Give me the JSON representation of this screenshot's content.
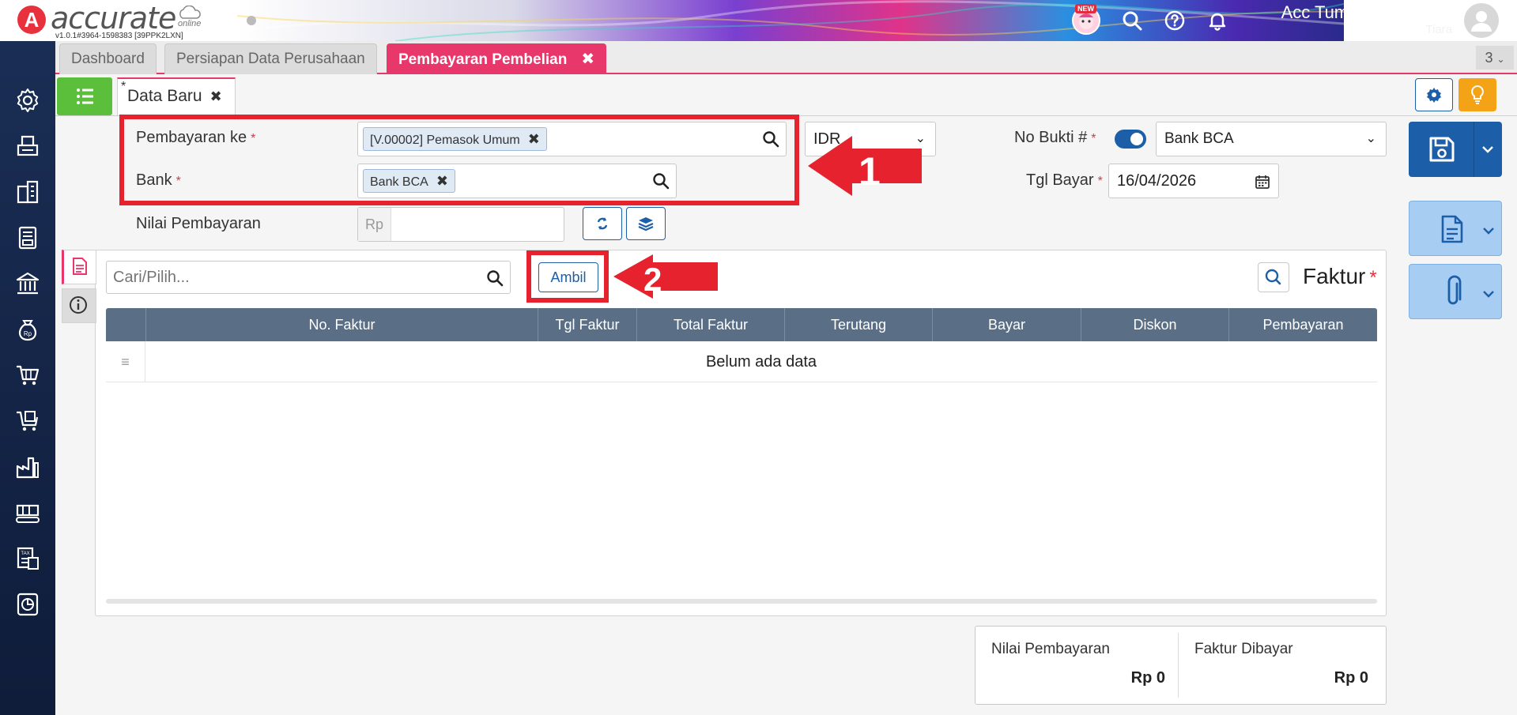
{
  "brand": {
    "logo_letter": "A",
    "name": "accurate",
    "cloud_text": "online",
    "version": "v1.0.1#3964-1598383 [39PPK2LXN]"
  },
  "header": {
    "new_badge": "NEW",
    "user_name": "Acc Tumbuh Bersama",
    "user_sub": "Tiara",
    "icons": [
      "search-icon",
      "help-icon",
      "bell-icon"
    ]
  },
  "sidebar": {
    "icons": [
      "gear-icon",
      "printer-icon",
      "building-icon",
      "book-icon",
      "bank-icon",
      "money-bag-icon",
      "cart-icon",
      "shopping-cart-icon",
      "factory-icon",
      "conveyor-icon",
      "tax-icon",
      "report-icon"
    ]
  },
  "tabs": {
    "items": [
      {
        "label": "Dashboard"
      },
      {
        "label": "Persiapan Data Perusahaan"
      },
      {
        "label": "Pembayaran Pembelian",
        "close": "✖"
      }
    ],
    "count": "3"
  },
  "subtab": {
    "star": "*",
    "label": "Data Baru",
    "close": "✖"
  },
  "form": {
    "pembayaran_ke_label": "Pembayaran ke",
    "pembayaran_ke_value": "[V.00002] Pemasok Umum",
    "bank_label": "Bank",
    "bank_value": "Bank BCA",
    "currency": "IDR",
    "no_bukti_label": "No Bukti #",
    "no_bukti_value": "Bank BCA",
    "tgl_bayar_label": "Tgl Bayar",
    "tgl_bayar_value": "16/04/2026",
    "nilai_label": "Nilai Pembayaran",
    "rp_prefix": "Rp",
    "required_mark": "*",
    "chip_close": "✖"
  },
  "annotations": {
    "step1": "1",
    "step2": "2",
    "color": "#e5222d"
  },
  "faktur": {
    "search_placeholder": "Cari/Pilih...",
    "ambil_label": "Ambil",
    "title": "Faktur",
    "columns": [
      "No. Faktur",
      "Tgl Faktur",
      "Total Faktur",
      "Terutang",
      "Bayar",
      "Diskon",
      "Pembayaran"
    ],
    "empty": "Belum ada data"
  },
  "summary": {
    "nilai_label": "Nilai Pembayaran",
    "nilai_value": "Rp 0",
    "faktur_label": "Faktur Dibayar",
    "faktur_value": "Rp 0"
  },
  "colors": {
    "accent": "#e8376a",
    "primary": "#1c5fa8",
    "sidebar": "#1a2e55",
    "success": "#5bbf3c",
    "warning": "#f4a216"
  }
}
